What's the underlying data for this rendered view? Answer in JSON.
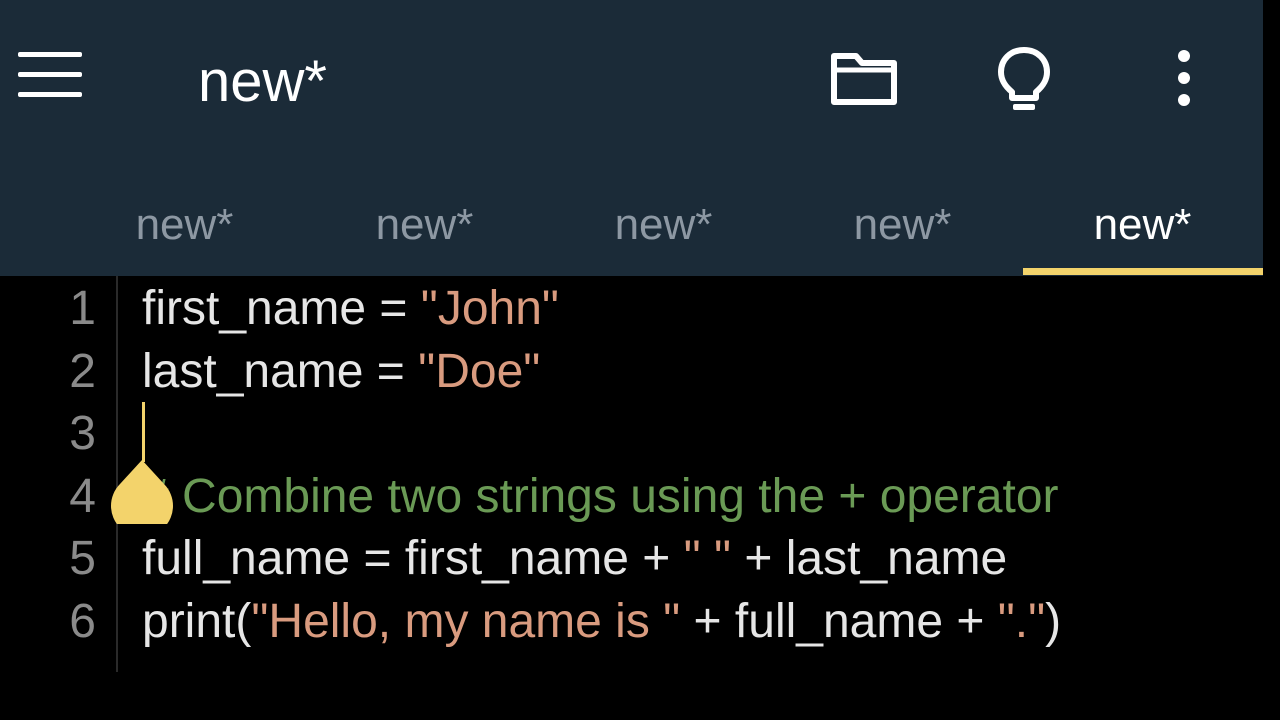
{
  "appbar": {
    "title": "new*",
    "icons": [
      "menu-icon",
      "folder-icon",
      "lightbulb-icon",
      "more-vert-icon"
    ]
  },
  "tabs": [
    {
      "label": "new*",
      "active": false
    },
    {
      "label": "new*",
      "active": false
    },
    {
      "label": "new*",
      "active": false
    },
    {
      "label": "new*",
      "active": false
    },
    {
      "label": "new*",
      "active": true
    }
  ],
  "editor": {
    "lines": [
      {
        "num": "1",
        "parts": [
          {
            "t": "first_name = ",
            "c": "plain"
          },
          {
            "t": "\"John\"",
            "c": "str"
          }
        ]
      },
      {
        "num": "2",
        "parts": [
          {
            "t": "last_name = ",
            "c": "plain"
          },
          {
            "t": "\"Doe\"",
            "c": "str"
          }
        ]
      },
      {
        "num": "3",
        "parts": []
      },
      {
        "num": "4",
        "parts": [
          {
            "t": "# Combine two strings using the + operator",
            "c": "cmt"
          }
        ]
      },
      {
        "num": "5",
        "parts": [
          {
            "t": "full_name = first_name + ",
            "c": "plain"
          },
          {
            "t": "\" \"",
            "c": "str"
          },
          {
            "t": " + last_name",
            "c": "plain"
          }
        ]
      },
      {
        "num": "6",
        "parts": [
          {
            "t": "print(",
            "c": "plain"
          },
          {
            "t": "\"Hello, my name is \"",
            "c": "str"
          },
          {
            "t": " + full_name + ",
            "c": "plain"
          },
          {
            "t": "\".\"",
            "c": "str"
          },
          {
            "t": ")",
            "c": "plain"
          }
        ]
      }
    ]
  },
  "colors": {
    "appbar_bg": "#1b2b38",
    "accent": "#f3d36b",
    "string": "#d99b7f",
    "comment": "#6a9a55",
    "code_text": "#e6e6e6"
  }
}
